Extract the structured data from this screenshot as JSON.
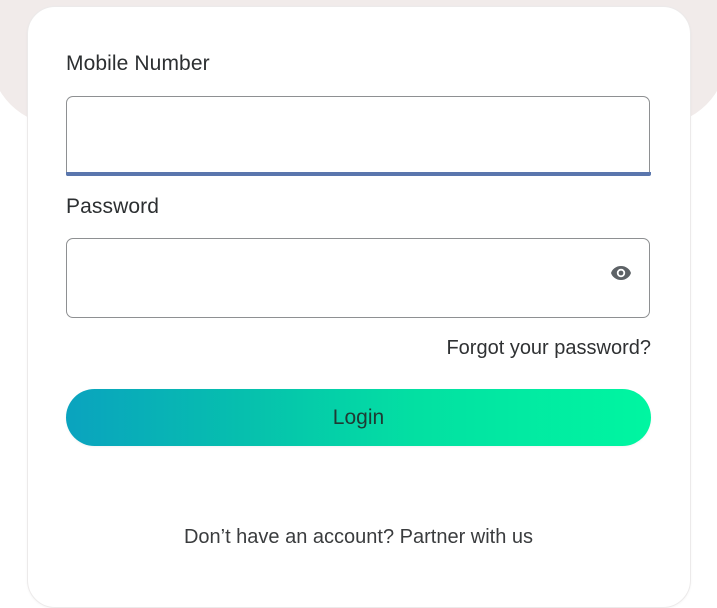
{
  "form": {
    "mobile_label": "Mobile Number",
    "mobile_value": "",
    "password_label": "Password",
    "password_value": "",
    "forgot_label": "Forgot your password?",
    "login_label": "Login",
    "signup_prompt": "Don’t have an account?",
    "signup_link": "Partner with us",
    "password_toggle_icon": "eye-icon"
  },
  "colors": {
    "focus_underline": "#5a76ad",
    "button_gradient_start": "#0aa3bf",
    "button_gradient_end": "#00f6a1",
    "background_blob": "#f1ebea"
  }
}
